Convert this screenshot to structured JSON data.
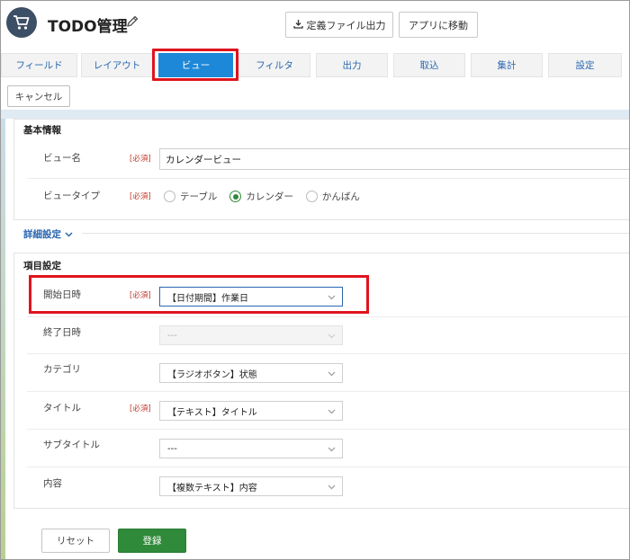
{
  "app": {
    "title": "TODO管理",
    "export_button": "定義ファイル出力",
    "goto_app_button": "アプリに移動"
  },
  "tabs": [
    {
      "label": "フィールド"
    },
    {
      "label": "レイアウト"
    },
    {
      "label": "ビュー",
      "active": true
    },
    {
      "label": "フィルタ"
    },
    {
      "label": "出力"
    },
    {
      "label": "取込"
    },
    {
      "label": "集計"
    },
    {
      "label": "設定"
    }
  ],
  "cancel_button": "キャンセル",
  "basic_info": {
    "title": "基本情報",
    "view_name_label": "ビュー名",
    "view_name_value": "カレンダービュー",
    "view_type_label": "ビュータイプ",
    "required": "[必須]",
    "view_type_options": [
      "テーブル",
      "カレンダー",
      "かんばん"
    ],
    "view_type_selected": "カレンダー"
  },
  "detail_settings": "詳細設定",
  "fields": {
    "title": "項目設定",
    "start_date_label": "開始日時",
    "start_date_value": "【日付期間】作業日",
    "end_date_label": "終了日時",
    "end_date_value": "---",
    "category_label": "カテゴリ",
    "category_value": "【ラジオボタン】状態",
    "title_label": "タイトル",
    "title_value": "【テキスト】タイトル",
    "subtitle_label": "サブタイトル",
    "subtitle_value": "---",
    "content_label": "内容",
    "content_value": "【複数テキスト】内容",
    "required": "[必須]"
  },
  "reset_button": "リセット",
  "submit_button": "登録",
  "colors": {
    "accent": "#1e88d8",
    "submit": "#2f8a3a",
    "highlight": "#e0141e",
    "link": "#2a67b0"
  }
}
